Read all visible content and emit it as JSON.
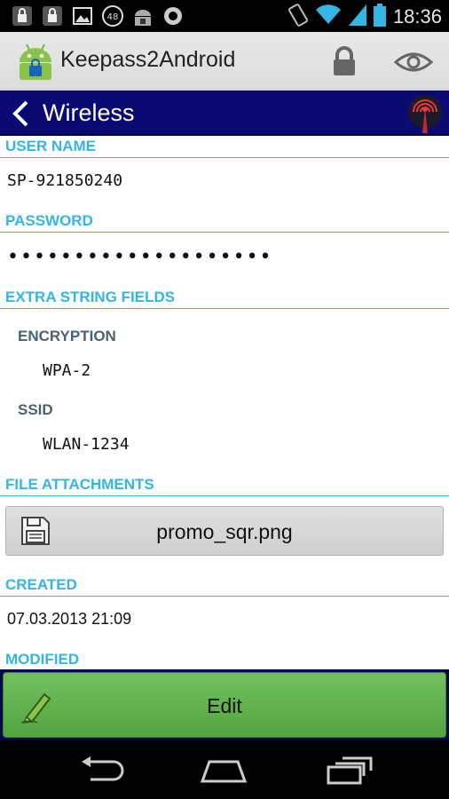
{
  "status_bar": {
    "time": "18:36",
    "notification_badge": "48",
    "icons": [
      "lock-icon",
      "lock-icon",
      "image-icon",
      "sync-badge-icon",
      "android-lock-icon",
      "circle-icon"
    ],
    "right_icons": [
      "vibrate-icon",
      "wifi-icon",
      "signal-icon",
      "battery-icon"
    ]
  },
  "action_bar": {
    "app_title": "Keepass2Android",
    "icons": [
      "app-logo-icon",
      "lock-icon",
      "eye-icon"
    ]
  },
  "header": {
    "title": "Wireless",
    "icon": "wireless-tower-icon"
  },
  "entry": {
    "user_name": {
      "label": "USER NAME",
      "value": "SP-921850240"
    },
    "password": {
      "label": "PASSWORD",
      "value": "••••••••••••••••••••"
    },
    "extra_fields": {
      "label": "EXTRA STRING FIELDS",
      "items": [
        {
          "key": "ENCRYPTION",
          "value": "WPA-2"
        },
        {
          "key": "SSID",
          "value": "WLAN-1234"
        }
      ]
    },
    "attachments": {
      "label": "FILE ATTACHMENTS",
      "files": [
        "promo_sqr.png"
      ]
    },
    "created": {
      "label": "CREATED",
      "value": "07.03.2013 21:09"
    },
    "modified": {
      "label": "MODIFIED"
    }
  },
  "edit_button": {
    "label": "Edit",
    "icon": "pencil-icon"
  },
  "nav_bar": {
    "icons": [
      "back-icon",
      "home-icon",
      "recent-apps-icon"
    ]
  },
  "colors": {
    "section_accent": "#33b5e5",
    "header_bg": "#0a0a72",
    "edit_green": "#5fb14b"
  }
}
